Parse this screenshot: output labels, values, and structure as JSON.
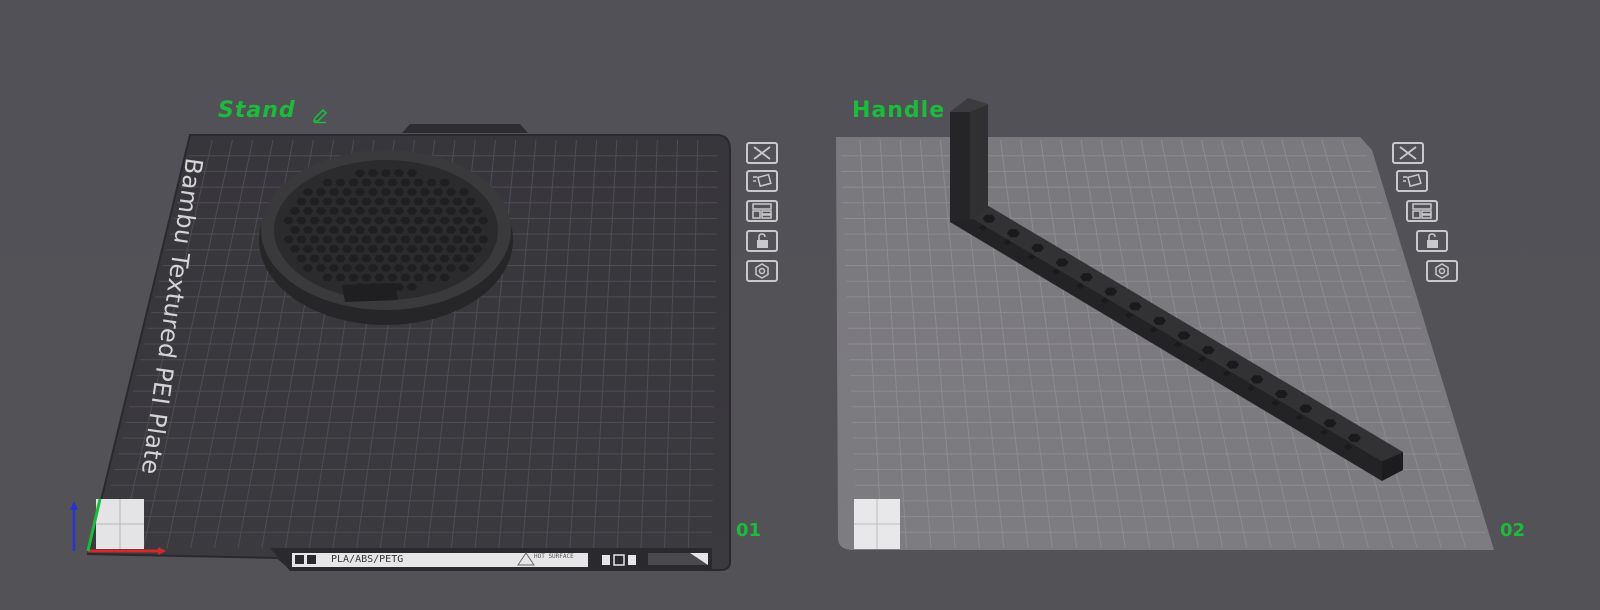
{
  "plates": [
    {
      "name": "Stand",
      "number": "01",
      "plate_type_text": "Bambu Textured PEI Plate",
      "material_label": "PLA/ABS/PETG",
      "hot_surface_label": "HOT SURFACE"
    },
    {
      "name": "Handle",
      "number": "02"
    }
  ],
  "plate_toolbar": {
    "buttons": [
      "close-icon",
      "auto-orient-icon",
      "arrange-icon",
      "lock-icon",
      "settings-icon"
    ]
  },
  "colors": {
    "background": "#525157",
    "plate_label_green": "#1dbb3b",
    "plate1_surface": "#38373c",
    "plate2_surface": "#78777c",
    "model": "#2b2b2d",
    "axis_x": "#d12a2a",
    "axis_y": "#1dbb3b",
    "axis_z": "#2a34c9"
  }
}
